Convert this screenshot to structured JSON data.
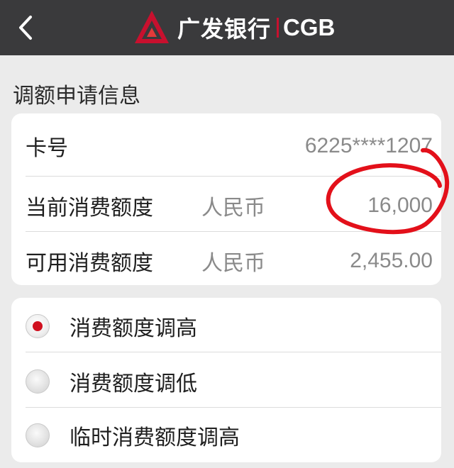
{
  "header": {
    "back_icon": "chevron-left-icon",
    "logo_icon": "cgb-logo-icon",
    "brand_cn": "广发银行",
    "brand_en": "CGB",
    "brand_color": "#c8102e",
    "bar_color": "#3a3a3c"
  },
  "section_title": "调额申请信息",
  "info": {
    "card_number_label": "卡号",
    "card_number_value": "6225****1207",
    "current_limit_label": "当前消费额度",
    "current_limit_currency": "人民币",
    "current_limit_value": "16,000",
    "available_limit_label": "可用消费额度",
    "available_limit_currency": "人民币",
    "available_limit_value": "2,455.00"
  },
  "options": [
    {
      "label": "消费额度调高",
      "selected": true
    },
    {
      "label": "消费额度调低",
      "selected": false
    },
    {
      "label": "临时消费额度调高",
      "selected": false
    }
  ],
  "accent_color": "#d0101f"
}
